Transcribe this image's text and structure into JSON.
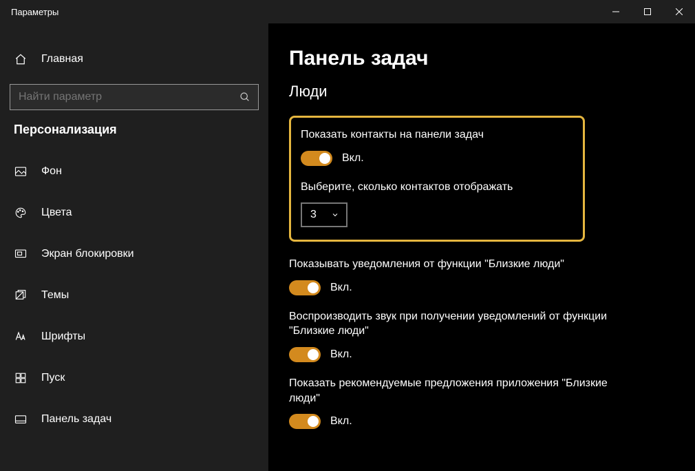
{
  "window": {
    "title": "Параметры"
  },
  "sidebar": {
    "home": "Главная",
    "search_placeholder": "Найти параметр",
    "section": "Персонализация",
    "items": [
      {
        "icon": "image",
        "label": "Фон"
      },
      {
        "icon": "palette",
        "label": "Цвета"
      },
      {
        "icon": "lockscreen",
        "label": "Экран блокировки"
      },
      {
        "icon": "themes",
        "label": "Темы"
      },
      {
        "icon": "fonts",
        "label": "Шрифты"
      },
      {
        "icon": "start",
        "label": "Пуск"
      },
      {
        "icon": "taskbar",
        "label": "Панель задач"
      }
    ]
  },
  "main": {
    "title": "Панель задач",
    "subsection": "Люди",
    "settings": [
      {
        "label": "Показать контакты на панели задач",
        "type": "toggle",
        "state": "Вкл."
      },
      {
        "label": "Выберите, сколько контактов отображать",
        "type": "dropdown",
        "value": "3"
      },
      {
        "label": "Показывать уведомления от функции \"Близкие люди\"",
        "type": "toggle",
        "state": "Вкл."
      },
      {
        "label": "Воспроизводить звук при получении уведомлений от функции \"Близкие люди\"",
        "type": "toggle",
        "state": "Вкл."
      },
      {
        "label": "Показать рекомендуемые предложения приложения \"Близкие люди\"",
        "type": "toggle",
        "state": "Вкл."
      }
    ]
  },
  "colors": {
    "accent": "#d38a1e",
    "highlight_border": "#e5b63f"
  }
}
